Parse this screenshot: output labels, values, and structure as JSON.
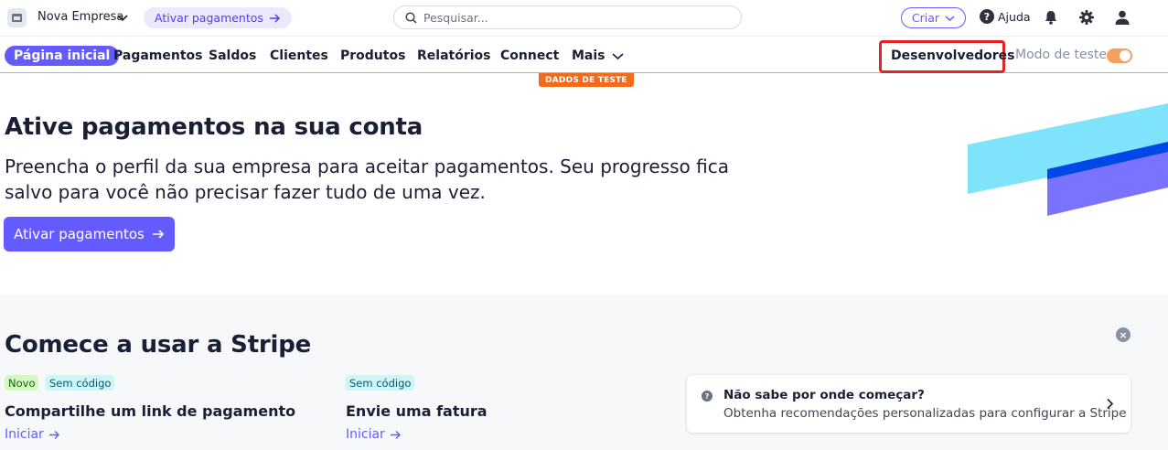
{
  "topbar": {
    "account_name": "Nova Empresa",
    "activate_pill": "Ativar pagamentos",
    "search_placeholder": "Pesquisar...",
    "create_label": "Criar",
    "help_label": "Ajuda",
    "icons": [
      "store-icon",
      "chevron-down-icon",
      "arrow-right-icon",
      "search-icon",
      "help-icon",
      "bell-icon",
      "gear-icon",
      "user-icon"
    ]
  },
  "nav": {
    "items": [
      "Página inicial",
      "Pagamentos",
      "Saldos",
      "Clientes",
      "Produtos",
      "Relatórios",
      "Connect",
      "Mais"
    ],
    "developers": "Desenvolvedores",
    "test_mode_label": "Modo de teste",
    "test_mode_on": true,
    "test_badge": "DADOS DE TESTE"
  },
  "hero": {
    "title": "Ative pagamentos na sua conta",
    "subtitle": "Preencha o perfil da sua empresa para aceitar pagamentos. Seu progresso fica salvo para você não precisar fazer tudo de uma vez.",
    "button": "Ativar pagamentos"
  },
  "get_started": {
    "title": "Comece a usar a Stripe",
    "cards": [
      {
        "tags": [
          "Novo",
          "Sem código"
        ],
        "title": "Compartilhe um link de pagamento",
        "link": "Iniciar"
      },
      {
        "tags": [
          "Sem código"
        ],
        "title": "Envie uma fatura",
        "link": "Iniciar"
      }
    ],
    "help_card": {
      "title": "Não sabe por onde começar?",
      "text": "Obtenha recomendações personalizadas para configurar a Stripe"
    }
  },
  "colors": {
    "accent": "#635bff",
    "test_orange": "#f26b1d",
    "highlight_red": "#e52222"
  }
}
